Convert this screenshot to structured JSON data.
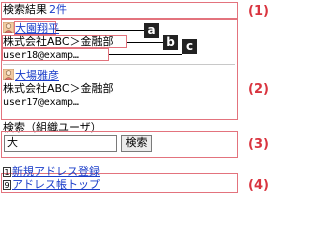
{
  "results_header": {
    "label": "検索結果",
    "count": "2件"
  },
  "results": [
    {
      "name": "大園翔平",
      "org": "株式会社ABC＞金融部",
      "email": "user18@examp…"
    },
    {
      "name": "大場雅彦",
      "org": "株式会社ABC＞金融部",
      "email": "user17@examp…"
    }
  ],
  "callouts": {
    "a": "a",
    "b": "b",
    "c": "c"
  },
  "search": {
    "label": "検索（組織ユーザ）",
    "value": "大",
    "button": "検索"
  },
  "links": [
    {
      "key": "1",
      "label": "新規アドレス登録"
    },
    {
      "key": "9",
      "label": "アドレス帳トップ"
    }
  ],
  "section_numbers": {
    "n1": "(1)",
    "n2": "(2)",
    "n3": "(3)",
    "n4": "(4)"
  },
  "colors": {
    "annotation": "#e3737d",
    "link": "#1a3dc9"
  }
}
